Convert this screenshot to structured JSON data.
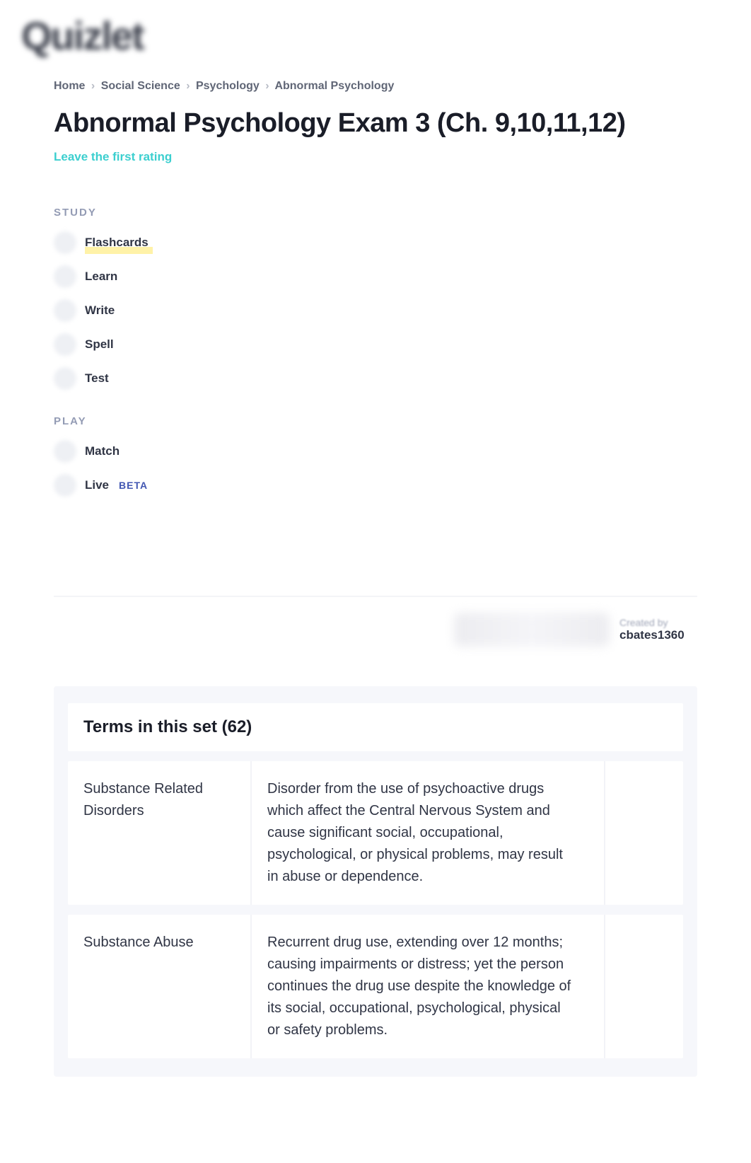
{
  "brand": "Quizlet",
  "breadcrumb": {
    "items": [
      "Home",
      "Social Science",
      "Psychology",
      "Abnormal Psychology"
    ]
  },
  "title": "Abnormal Psychology Exam 3 (Ch. 9,10,11,12)",
  "rating_cta": "Leave the first rating",
  "study": {
    "label": "STUDY",
    "modes": [
      {
        "label": "Flashcards",
        "highlight": true
      },
      {
        "label": "Learn"
      },
      {
        "label": "Write"
      },
      {
        "label": "Spell"
      },
      {
        "label": "Test"
      }
    ]
  },
  "play": {
    "label": "PLAY",
    "modes": [
      {
        "label": "Match"
      },
      {
        "label": "Live",
        "badge": "BETA"
      }
    ]
  },
  "creator": {
    "created_by_label": "Created by",
    "username": "cbates1360"
  },
  "terms_header": "Terms in this set (62)",
  "terms": [
    {
      "term": "Substance Related Disorders",
      "definition": "Disorder from the use of psychoactive drugs which affect the Central Nervous System and cause significant social, occupational, psychological, or physical problems, may result in abuse or dependence."
    },
    {
      "term": "Substance Abuse",
      "definition": "Recurrent drug use, extending over 12 months; causing impairments or distress; yet the person continues the drug use despite the knowledge of its social, occupational, psychological, physical or safety problems."
    }
  ]
}
